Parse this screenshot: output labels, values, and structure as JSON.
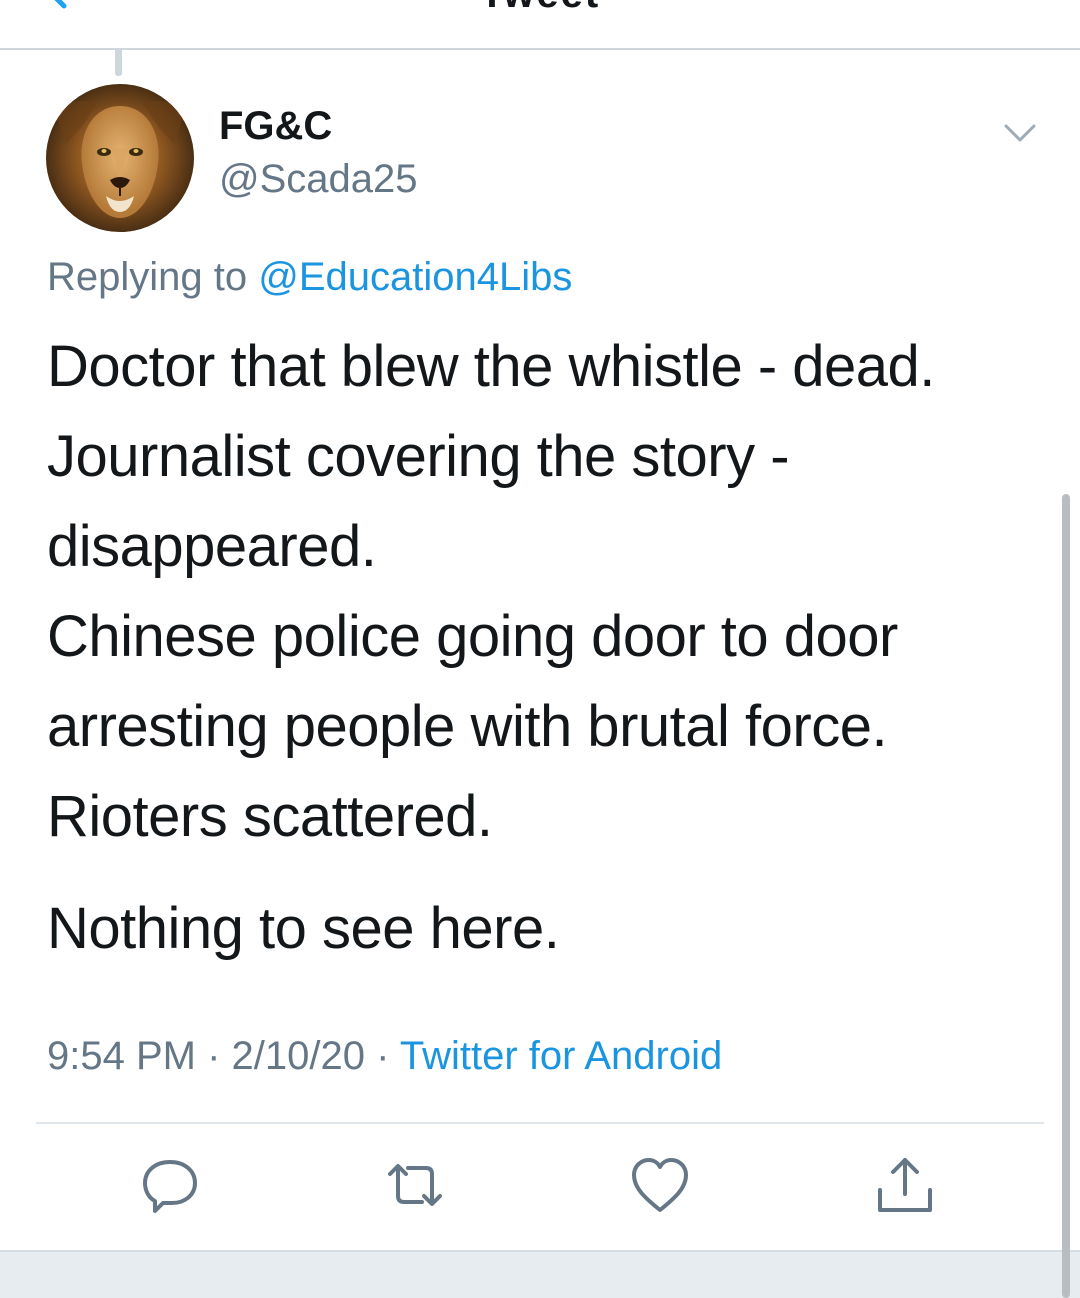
{
  "nav": {
    "title": "Tweet"
  },
  "tweet": {
    "author_name": "FG&C",
    "author_handle": "@Scada25",
    "replying_prefix": "Replying to",
    "replying_to": "@Education4Libs",
    "body_lines": [
      "Doctor that blew the whistle - dead.",
      "Journalist covering the story -",
      "disappeared.",
      "Chinese police going door to door",
      "arresting people with brutal force.",
      "Rioters scattered."
    ],
    "body_last": "Nothing to see here.",
    "time": "9:54 PM",
    "separator": "·",
    "date": "2/10/20",
    "source": "Twitter for Android"
  },
  "icons": {
    "back": "chevron-left-icon",
    "more": "chevron-down-icon",
    "reply": "speech-bubble-icon",
    "retweet": "retweet-icon",
    "like": "heart-icon",
    "share": "share-icon"
  },
  "colors": {
    "link": "#1b95e0",
    "secondary_text": "#657786",
    "primary_text": "#14171a",
    "icon": "#657786"
  }
}
